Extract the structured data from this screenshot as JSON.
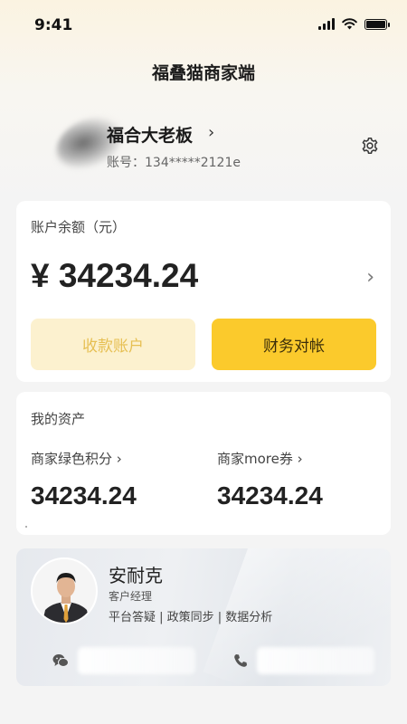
{
  "status_bar": {
    "time": "9:41"
  },
  "header": {
    "title": "福叠猫商家端"
  },
  "profile": {
    "name": "福合大老板",
    "account": "账号：134*****2121e",
    "arrow": "›"
  },
  "balance": {
    "label": "账户余额（元）",
    "amount": "¥ 34234.24",
    "arrow": "›",
    "btn_receive": "收款账户",
    "btn_finance": "财务对帐"
  },
  "assets": {
    "title": "我的资产",
    "green_points_label": "商家绿色积分 ›",
    "green_points_value": "34234.24",
    "more_coupon_label": "商家more券 ›",
    "more_coupon_value": "34234.24"
  },
  "manager": {
    "name": "安耐克",
    "role": "客户经理",
    "tags": "平台答疑 | 政策同步 | 数据分析"
  },
  "colors": {
    "accent": "#fbca2c",
    "accent_light": "#fcf1cf",
    "header_bg": "#fbf3e1"
  },
  "icons": [
    "settings-gear-icon",
    "chevron-right-icon",
    "wechat-icon",
    "phone-icon",
    "wifi-icon",
    "signal-icon",
    "battery-icon"
  ]
}
